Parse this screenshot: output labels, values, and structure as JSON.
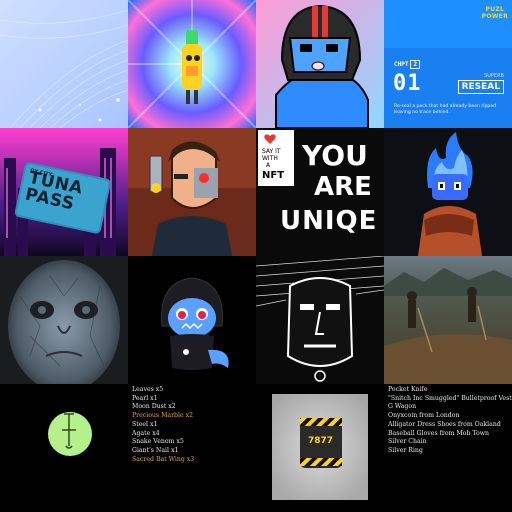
{
  "tiles": [
    {
      "name": "abstract-blue-curves",
      "kind": "art"
    },
    {
      "name": "psychedelic-vape-character",
      "kind": "art"
    },
    {
      "name": "helmeted-blue-creature",
      "kind": "art"
    },
    {
      "name": "puzl-card",
      "kind": "art"
    },
    {
      "name": "tuna-pass",
      "kind": "art"
    },
    {
      "name": "cyborg-gunman",
      "kind": "art"
    },
    {
      "name": "you-are-unique",
      "kind": "art"
    },
    {
      "name": "blue-flame-creature",
      "kind": "art"
    },
    {
      "name": "cracked-face-portrait",
      "kind": "art"
    },
    {
      "name": "hooded-shark",
      "kind": "art"
    },
    {
      "name": "sketch-face",
      "kind": "art"
    },
    {
      "name": "farmers-field",
      "kind": "art"
    },
    {
      "name": "green-glyph-circle",
      "kind": "art"
    },
    {
      "name": "ingredient-list",
      "kind": "text"
    },
    {
      "name": "hazard-box",
      "kind": "art"
    },
    {
      "name": "loot-list",
      "kind": "text"
    },
    {
      "name": "filler",
      "kind": "art"
    }
  ],
  "puzl": {
    "logo_top": "PUZL",
    "logo_bottom": "POWER",
    "chapter_label": "CHPT",
    "chapter_num": "2",
    "number": "01",
    "rarity": "SUPERB",
    "name": "RESEAL",
    "description": "Re-seal a pack that had already been ripped leaving no trace behind."
  },
  "tuna": {
    "city": "OX CITY",
    "title": "TUNA PASS"
  },
  "unique": {
    "say_it": "SAY IT WITH",
    "a": "A",
    "nft": "NFT",
    "line1": "YOU",
    "line2": "ARE",
    "line3": "UNIQE"
  },
  "hazard_box": {
    "label": "7877"
  },
  "ingredients": [
    {
      "text": "Leaves x5",
      "highlight": false
    },
    {
      "text": "Pearl x1",
      "highlight": false
    },
    {
      "text": "Moon Dust x2",
      "highlight": false
    },
    {
      "text": "Precious Marble x2",
      "highlight": true
    },
    {
      "text": "Steel x1",
      "highlight": false
    },
    {
      "text": "Agate x4",
      "highlight": false
    },
    {
      "text": "Snake Venom x5",
      "highlight": false
    },
    {
      "text": "Giant's Nail x1",
      "highlight": false
    },
    {
      "text": "Sacred Bat Wing x3",
      "highlight": true
    }
  ],
  "loot": [
    "Pocket Knife",
    "\"Snitch Inc Smuggled\" Bulletproof Vest from the",
    "G Wagon",
    "Onyxcoin from London",
    "Alligator Dress Shoes from Oakland",
    "Baseball Gloves from Mob Town",
    "Silver Chain",
    "Silver Ring"
  ]
}
